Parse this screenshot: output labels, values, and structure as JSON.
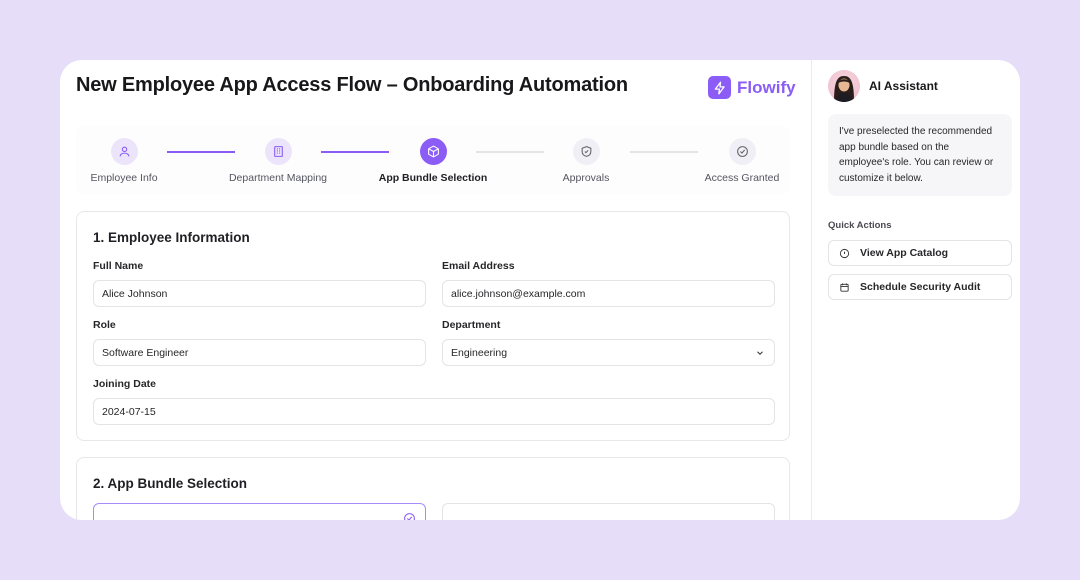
{
  "header": {
    "title": "New Employee App Access Flow – Onboarding Automation",
    "brand": "Flowify"
  },
  "stepper": {
    "steps": [
      {
        "label": "Employee Info",
        "icon": "user-icon",
        "state": "done"
      },
      {
        "label": "Department Mapping",
        "icon": "building-icon",
        "state": "done"
      },
      {
        "label": "App Bundle Selection",
        "icon": "package-icon",
        "state": "active"
      },
      {
        "label": "Approvals",
        "icon": "shield-check-icon",
        "state": "pending"
      },
      {
        "label": "Access Granted",
        "icon": "check-circle-icon",
        "state": "pending"
      }
    ]
  },
  "employee_info": {
    "title": "1. Employee Information",
    "full_name_label": "Full Name",
    "full_name": "Alice Johnson",
    "email_label": "Email Address",
    "email": "alice.johnson@example.com",
    "role_label": "Role",
    "role": "Software Engineer",
    "department_label": "Department",
    "department": "Engineering",
    "joining_label": "Joining Date",
    "joining_date": "2024-07-15"
  },
  "bundle": {
    "title": "2. App Bundle Selection"
  },
  "assistant": {
    "name": "AI Assistant",
    "message": "I've preselected the recommended app bundle based on the employee's role. You can review or customize it below.",
    "quick_actions_title": "Quick Actions",
    "actions": [
      {
        "label": "View App Catalog",
        "icon": "info-icon"
      },
      {
        "label": "Schedule Security Audit",
        "icon": "calendar-icon"
      }
    ]
  },
  "colors": {
    "accent": "#8b5cf6",
    "background": "#e6ddf8"
  }
}
